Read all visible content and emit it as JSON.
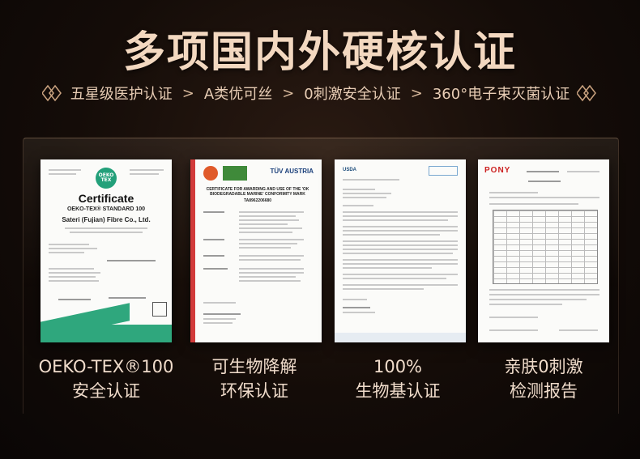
{
  "header": {
    "title": "多项国内外硬核认证",
    "features": [
      "五星级医护认证",
      "A类优可丝",
      "0刺激安全认证",
      "360°电子束灭菌认证"
    ],
    "separator": ">"
  },
  "certificates": [
    {
      "doc_title": "Certificate",
      "doc_standard": "OEKO-TEX® STANDARD 100",
      "doc_company": "Sateri (Fujian) Fibre Co., Ltd.",
      "logo_text": "OEKO TEX",
      "caption_line1": "OEKO-TEX®100",
      "caption_line2": "安全认证"
    },
    {
      "doc_title": "CERTIFICATE FOR AWARDING AND USE OF THE 'OK BIODEGRADABLE MARINE' CONFORMITY MARK",
      "doc_number": "TA8962206680",
      "logo_text": "TÜV AUSTRIA",
      "caption_line1": "可生物降解",
      "caption_line2": "环保认证"
    },
    {
      "logo_text": "USDA",
      "caption_line1": "100%",
      "caption_line2": "生物基认证"
    },
    {
      "logo_text": "PONY",
      "caption_line1": "亲肤0刺激",
      "caption_line2": "检测报告"
    }
  ],
  "colors": {
    "background": "#140c08",
    "title": "#f3d8c0",
    "oeko_green": "#2fa77d",
    "tuv_red": "#d23b3b"
  }
}
